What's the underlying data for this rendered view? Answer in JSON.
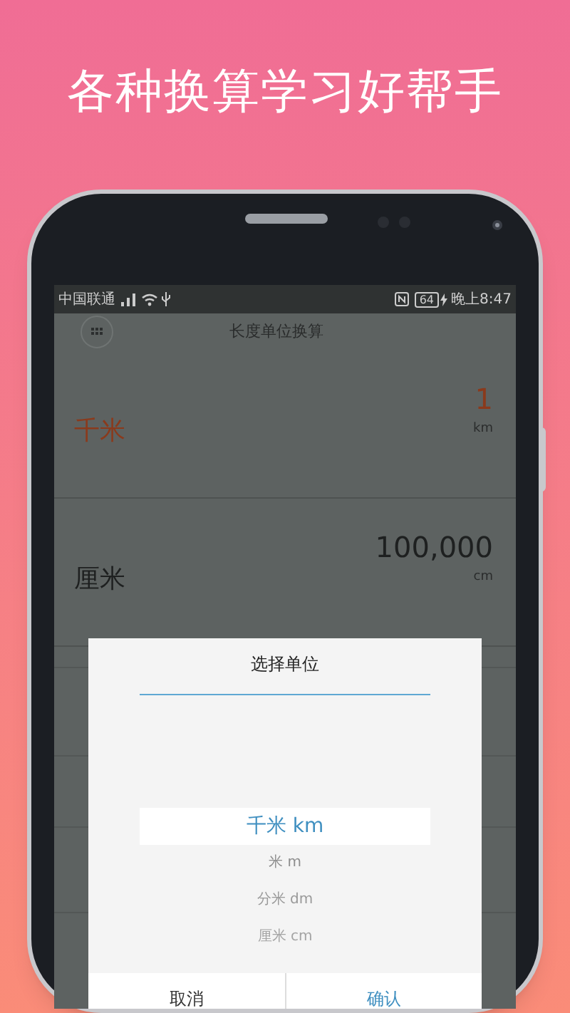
{
  "headline": "各种换算学习好帮手",
  "status_bar": {
    "carrier": "中国联通",
    "battery": "64",
    "time": "晚上8:47"
  },
  "app_header": {
    "title": "长度单位换算"
  },
  "conversions": [
    {
      "unit": "千米",
      "value": "1",
      "symbol": "km",
      "active": true
    },
    {
      "unit": "厘米",
      "value": "100,000",
      "symbol": "cm",
      "active": false
    }
  ],
  "dialog": {
    "title": "选择单位",
    "options": [
      {
        "label": "千米 km",
        "selected": true
      },
      {
        "label": "米 m",
        "selected": false
      },
      {
        "label": "分米 dm",
        "selected": false
      },
      {
        "label": "厘米 cm",
        "selected": false
      }
    ],
    "buttons": [
      {
        "label": "取消",
        "kind": "cancel"
      },
      {
        "label": "确认",
        "kind": "confirm"
      }
    ]
  }
}
